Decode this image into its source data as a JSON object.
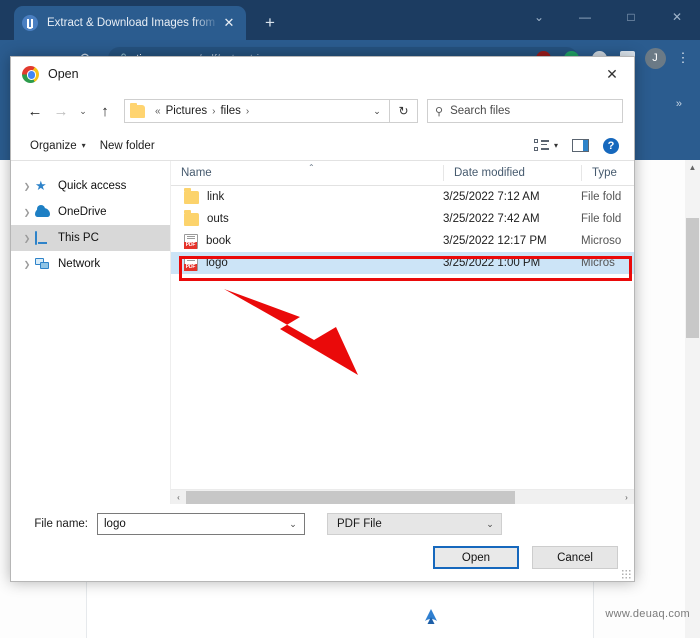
{
  "browser": {
    "tab": {
      "title": "Extract & Download Images from",
      "close_label": "✕",
      "favicon": "tinywow-icon"
    },
    "new_tab_label": "+",
    "window_controls": [
      {
        "name": "chevron-down",
        "glyph": "⌄"
      },
      {
        "name": "minimize",
        "glyph": "—"
      },
      {
        "name": "maximize",
        "glyph": "□"
      },
      {
        "name": "close",
        "glyph": "✕"
      }
    ],
    "nav": [
      {
        "name": "back",
        "glyph": "←"
      },
      {
        "name": "forward",
        "glyph": "→"
      },
      {
        "name": "reload",
        "glyph": "⟳"
      },
      {
        "name": "home",
        "glyph": "⌂"
      }
    ],
    "omnibox": {
      "lock": "🔒",
      "domain": "tinywow.com",
      "path": "/pdf/extract-images"
    },
    "toolbar_right": {
      "avatar_initial": "J",
      "kebab": "⋮"
    },
    "bookmarks_overflow": "»",
    "watermark": "www.deuaq.com"
  },
  "dialog": {
    "title": "Open",
    "close_label": "✕",
    "nav": {
      "back": "←",
      "forward": "→",
      "recent": "⌄",
      "up": "↑"
    },
    "breadcrumb": {
      "prefix": "«",
      "items": [
        "Pictures",
        "files"
      ],
      "separator": "›",
      "caret": "⌄"
    },
    "refresh": "↻",
    "search": {
      "placeholder": "Search files",
      "icon": "search-icon"
    },
    "toolbar": {
      "organize": "Organize",
      "organize_caret": "▾",
      "new_folder": "New folder",
      "view_caret": "▾",
      "help": "?"
    },
    "sidebar": {
      "items": [
        {
          "label": "Quick access",
          "icon": "star-icon",
          "selected": false
        },
        {
          "label": "OneDrive",
          "icon": "cloud-icon",
          "selected": false
        },
        {
          "label": "This PC",
          "icon": "monitor-icon",
          "selected": true
        },
        {
          "label": "Network",
          "icon": "network-icon",
          "selected": false
        }
      ]
    },
    "columns": [
      {
        "label": "Name",
        "sorted": "asc",
        "caret": "⌃"
      },
      {
        "label": "Date modified",
        "sorted": ""
      },
      {
        "label": "Type",
        "sorted": ""
      }
    ],
    "files": [
      {
        "name": "link",
        "date": "3/25/2022 7:12 AM",
        "type": "File fold",
        "icon": "folder-icon",
        "selected": false
      },
      {
        "name": "outs",
        "date": "3/25/2022 7:42 AM",
        "type": "File fold",
        "icon": "folder-icon",
        "selected": false
      },
      {
        "name": "book",
        "date": "3/25/2022 12:17 PM",
        "type": "Microso",
        "icon": "pdf-icon",
        "selected": false
      },
      {
        "name": "logo",
        "date": "3/25/2022 1:00 PM",
        "type": "Micros",
        "icon": "pdf-icon",
        "selected": true
      }
    ],
    "pdf_badge": "PDF",
    "hscroll": {
      "left": "‹",
      "right": "›"
    },
    "footer": {
      "file_name_label": "File name:",
      "file_name_value": "logo",
      "file_name_caret": "⌄",
      "file_type_value": "PDF File",
      "file_type_caret": "⌄",
      "open_button": "Open",
      "cancel_button": "Cancel"
    }
  },
  "annotation": {
    "highlight_color": "#ea0a0a",
    "arrow_color": "#ea0a0a",
    "target": "logo"
  }
}
